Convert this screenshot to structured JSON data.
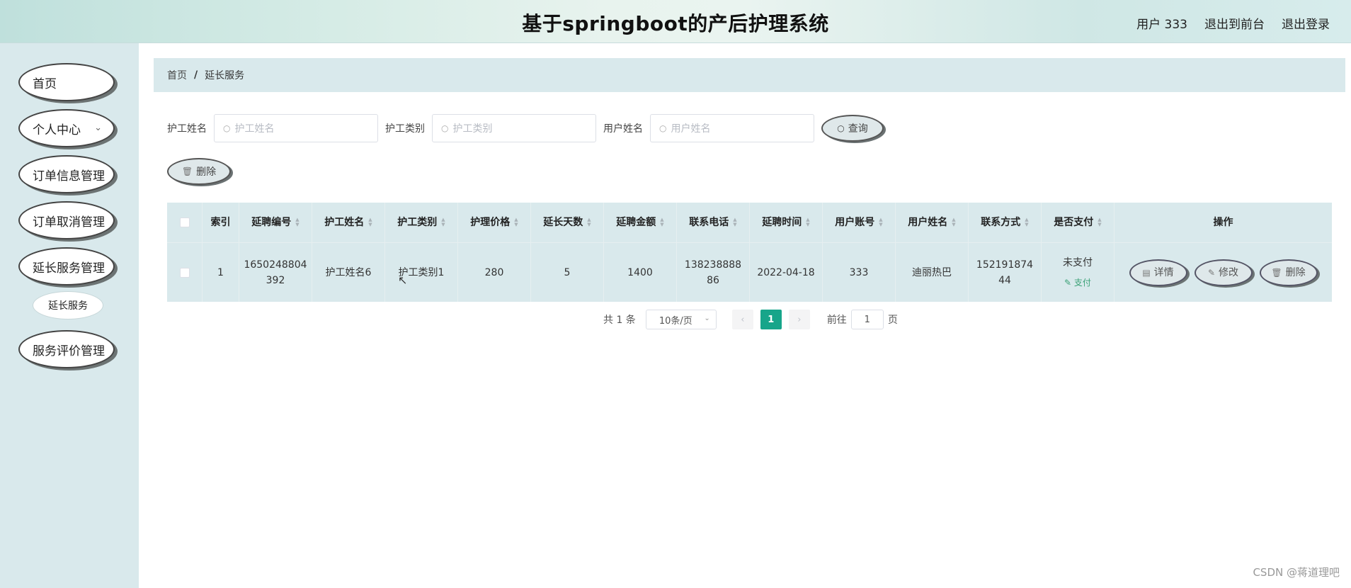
{
  "header": {
    "title": "基于springboot的产后护理系统",
    "user": "用户 333",
    "back_front": "退出到前台",
    "logout": "退出登录"
  },
  "sidebar": {
    "items": [
      {
        "label": "首页"
      },
      {
        "label": "个人中心"
      },
      {
        "label": "订单信息管理"
      },
      {
        "label": "订单取消管理"
      },
      {
        "label": "延长服务管理"
      },
      {
        "label": "服务评价管理"
      }
    ],
    "sub_item": "延长服务"
  },
  "breadcrumb": {
    "home": "首页",
    "sep": "/",
    "current": "延长服务"
  },
  "search": {
    "caregiver_label": "护工姓名",
    "caregiver_placeholder": "护工姓名",
    "type_label": "护工类别",
    "type_placeholder": "护工类别",
    "user_label": "用户姓名",
    "user_placeholder": "用户姓名",
    "query_label": "查询"
  },
  "toolbar": {
    "delete_label": "删除"
  },
  "table": {
    "columns": [
      "索引",
      "延聘编号",
      "护工姓名",
      "护工类别",
      "护理价格",
      "延长天数",
      "延聘金额",
      "联系电话",
      "延聘时间",
      "用户账号",
      "用户姓名",
      "联系方式",
      "是否支付",
      "操作"
    ],
    "row": {
      "index": "1",
      "extend_no_1": "1650248804",
      "extend_no_2": "392",
      "caregiver": "护工姓名6",
      "type": "护工类别1",
      "price": "280",
      "days": "5",
      "amount": "1400",
      "phone_1": "138238888",
      "phone_2": "86",
      "time": "2022-04-18",
      "account": "333",
      "username": "迪丽热巴",
      "contact_1": "152191874",
      "contact_2": "44",
      "paid": "未支付",
      "pay_link": "支付",
      "detail": "详情",
      "edit": "修改",
      "delete": "删除"
    }
  },
  "pager": {
    "total": "共 1 条",
    "size": "10条/页",
    "current": "1",
    "goto": "前往",
    "goto_value": "1",
    "page": "页"
  },
  "watermark": "CSDN @蒋道理吧"
}
